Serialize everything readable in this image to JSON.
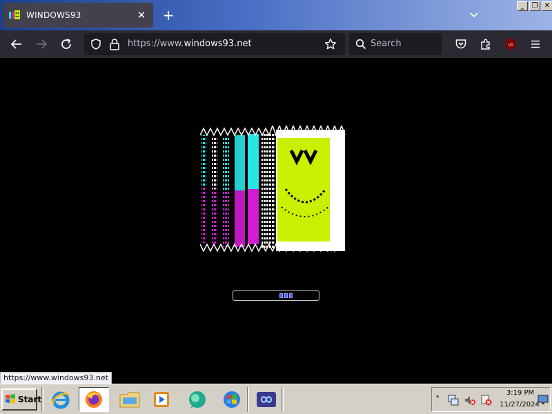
{
  "browser": {
    "tab": {
      "title": "WINDOWS93",
      "close_glyph": "✕",
      "favicon": "windows93-favicon"
    },
    "new_tab_glyph": "+",
    "window_controls": [
      "_",
      "❐",
      "✕"
    ],
    "url": {
      "prefix": "https://www.",
      "host": "windows93.net"
    },
    "search_placeholder": "Search",
    "extension_badge": "uo"
  },
  "page": {
    "loading_progress": 0.5,
    "status_link": "https://www.windows93.net",
    "colors": {
      "background": "#000000",
      "lime": "#c8f000",
      "cyan": "#29e6e6",
      "magenta": "#d21cd2",
      "loader": "#4a5cff"
    }
  },
  "taskbar": {
    "start_label": "Start",
    "apps": [
      "internet-explorer-icon",
      "firefox-icon",
      "file-explorer-icon",
      "media-player-icon",
      "messenger-icon",
      "windows-update-icon",
      "infinity-app-icon"
    ],
    "tray": {
      "time": "3:19 PM",
      "date": "11/27/2024",
      "expand_glyph": "˄"
    }
  }
}
